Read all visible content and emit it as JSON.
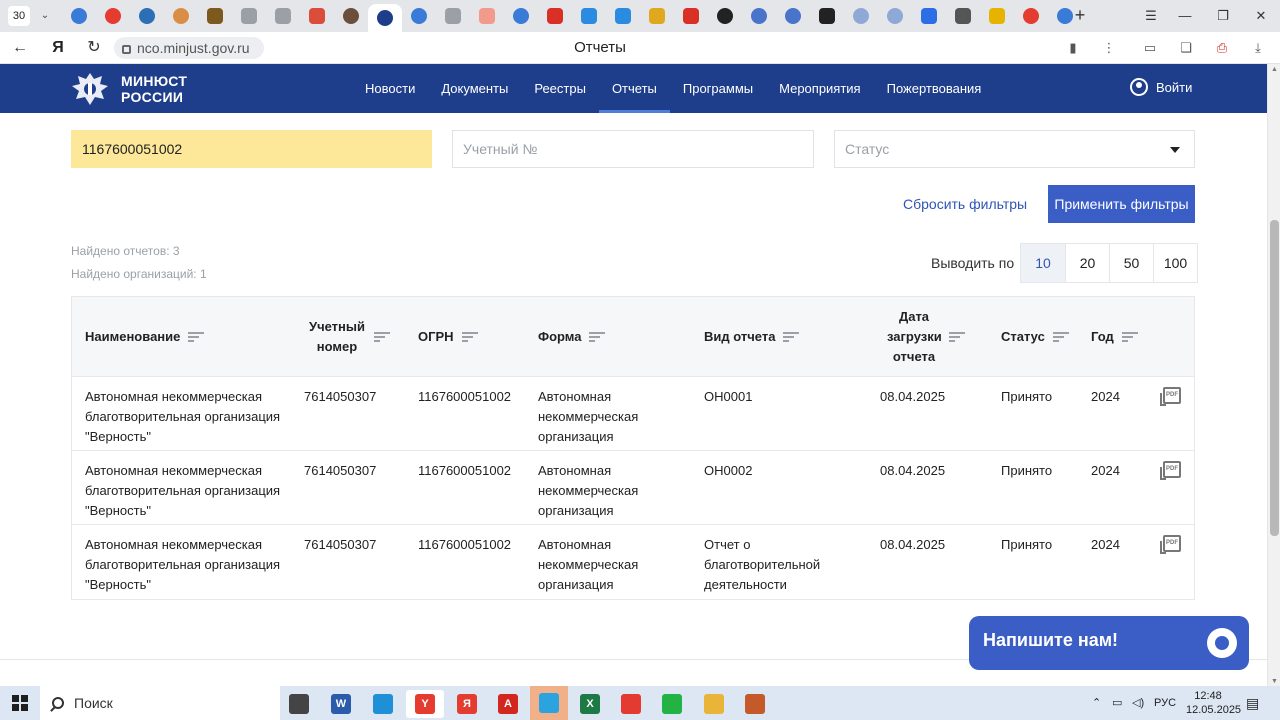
{
  "browser": {
    "tab_count": "30",
    "tab_icons": [
      {
        "name": "edge-tab-icon",
        "color": "#3b7bd8",
        "round": true
      },
      {
        "name": "yandex-tab-icon",
        "color": "#e43c2f",
        "round": true
      },
      {
        "name": "site-tab-icon",
        "color": "#2c6fb5",
        "round": true
      },
      {
        "name": "bunny-tab-icon",
        "color": "#d88f45",
        "round": true
      },
      {
        "name": "mask-tab-icon",
        "color": "#7c5a1e",
        "round": false
      },
      {
        "name": "document-tab-icon",
        "color": "#9aa0a6",
        "round": false
      },
      {
        "name": "document-tab-icon",
        "color": "#9aa0a6",
        "round": false
      },
      {
        "name": "grid-tab-icon",
        "color": "#d94d3a",
        "round": false
      },
      {
        "name": "avatar-tab-icon",
        "color": "#6b4f3a",
        "round": true
      },
      {
        "name": "minjust-tab-icon",
        "color": "#1e3e8c",
        "round": true,
        "active": true
      },
      {
        "name": "edge-tab-icon",
        "color": "#3b7bd8",
        "round": true
      },
      {
        "name": "document-tab-icon",
        "color": "#9aa0a6",
        "round": false
      },
      {
        "name": "file-tab-icon",
        "color": "#f29b8c",
        "round": false
      },
      {
        "name": "edge-tab-icon",
        "color": "#3b7bd8",
        "round": true
      },
      {
        "name": "house-tab-icon",
        "color": "#d93025",
        "round": false
      },
      {
        "name": "shield-tab-icon",
        "color": "#2b8be0",
        "round": false
      },
      {
        "name": "shield-tab-icon",
        "color": "#2b8be0",
        "round": false
      },
      {
        "name": "lock-tab-icon",
        "color": "#e0a81e",
        "round": false
      },
      {
        "name": "gmail-tab-icon",
        "color": "#d93025",
        "round": false
      },
      {
        "name": "arrow-tab-icon",
        "color": "#222222",
        "round": true
      },
      {
        "name": "crown-tab-icon",
        "color": "#4a74c9",
        "round": true
      },
      {
        "name": "crown-tab-icon",
        "color": "#4a74c9",
        "round": true
      },
      {
        "name": "tv-tab-icon",
        "color": "#222222",
        "round": false
      },
      {
        "name": "site-tab-icon",
        "color": "#8fa9d6",
        "round": true
      },
      {
        "name": "site-tab-icon",
        "color": "#8fa9d6",
        "round": true
      },
      {
        "name": "docs-tab-icon",
        "color": "#2b6ee6",
        "round": false
      },
      {
        "name": "flag-tab-icon",
        "color": "#555555",
        "round": false
      },
      {
        "name": "mail-tab-icon",
        "color": "#e6b400",
        "round": false
      },
      {
        "name": "yandex-tab-icon",
        "color": "#e43c2f",
        "round": true
      },
      {
        "name": "edge-tab-icon",
        "color": "#3b7bd8",
        "round": true
      }
    ],
    "url": "nco.minjust.gov.ru",
    "page_title": "Отчеты"
  },
  "site": {
    "brand_line1": "МИНЮСТ",
    "brand_line2": "РОССИИ",
    "nav": [
      {
        "label": "Новости",
        "active": false
      },
      {
        "label": "Документы",
        "active": false
      },
      {
        "label": "Реестры",
        "active": false
      },
      {
        "label": "Отчеты",
        "active": true
      },
      {
        "label": "Программы",
        "active": false
      },
      {
        "label": "Мероприятия",
        "active": false
      },
      {
        "label": "Пожертвования",
        "active": false
      }
    ],
    "login_label": "Войти",
    "primary_color": "#1e3e8c",
    "accent_color": "#3b5ec6"
  },
  "filters": {
    "ogrn_value": "1167600051002",
    "uchet_placeholder": "Учетный №",
    "status_placeholder": "Статус",
    "reset_label": "Сбросить фильтры",
    "apply_label": "Применить фильтры"
  },
  "summary": {
    "reports_label": "Найдено отчетов:",
    "reports_count": "3",
    "orgs_label": "Найдено организаций:",
    "orgs_count": "1"
  },
  "pagination": {
    "label": "Выводить по",
    "options": [
      "10",
      "20",
      "50",
      "100"
    ],
    "selected": "10"
  },
  "table": {
    "columns": [
      {
        "key": "name",
        "label": "Наименование"
      },
      {
        "key": "uchet",
        "label": "Учетный номер"
      },
      {
        "key": "ogrn",
        "label": "ОГРН"
      },
      {
        "key": "form",
        "label": "Форма"
      },
      {
        "key": "type",
        "label": "Вид отчета"
      },
      {
        "key": "date",
        "label": "Дата загрузки отчета"
      },
      {
        "key": "status",
        "label": "Статус"
      },
      {
        "key": "year",
        "label": "Год"
      }
    ],
    "rows": [
      {
        "name": "Автономная некоммерческая благотворительная организация \"Верность\"",
        "uchet": "7614050307",
        "ogrn": "1167600051002",
        "form": "Автономная некоммерческая организация",
        "type": "ОН0001",
        "date": "08.04.2025",
        "status": "Принято",
        "year": "2024"
      },
      {
        "name": "Автономная некоммерческая благотворительная организация \"Верность\"",
        "uchet": "7614050307",
        "ogrn": "1167600051002",
        "form": "Автономная некоммерческая организация",
        "type": "ОН0002",
        "date": "08.04.2025",
        "status": "Принято",
        "year": "2024"
      },
      {
        "name": "Автономная некоммерческая благотворительная организация \"Верность\"",
        "uchet": "7614050307",
        "ogrn": "1167600051002",
        "form": "Автономная некоммерческая организация",
        "type": "Отчет о благотворительной деятельности",
        "date": "08.04.2025",
        "status": "Принято",
        "year": "2024"
      }
    ],
    "pdf_icon_text": "PDF"
  },
  "chat": {
    "label": "Напишите нам!"
  },
  "taskbar": {
    "search_label": "Поиск",
    "apps": [
      {
        "name": "task-view-icon",
        "color": "#444444",
        "glyph": ""
      },
      {
        "name": "word-app-icon",
        "color": "#2b5cab",
        "glyph": "W"
      },
      {
        "name": "edge-app-icon",
        "color": "#1f8fd6",
        "glyph": ""
      },
      {
        "name": "yandex-browser-app-icon",
        "color": "#e43c2f",
        "glyph": "Y",
        "active": true
      },
      {
        "name": "yandex-app-icon",
        "color": "#e43c2f",
        "glyph": "Я"
      },
      {
        "name": "acrobat-app-icon",
        "color": "#d3261e",
        "glyph": "A"
      },
      {
        "name": "telegram-app-icon",
        "color": "#2aa3de",
        "glyph": "",
        "highlight": true
      },
      {
        "name": "excel-app-icon",
        "color": "#1d7a45",
        "glyph": "X"
      },
      {
        "name": "anydesk-app-icon",
        "color": "#e53a2f",
        "glyph": ""
      },
      {
        "name": "whatsapp-app-icon",
        "color": "#25b244",
        "glyph": ""
      },
      {
        "name": "explorer-app-icon",
        "color": "#e8b53a",
        "glyph": ""
      },
      {
        "name": "app-icon",
        "color": "#c45a2a",
        "glyph": ""
      }
    ],
    "language": "РУС",
    "time": "12:48",
    "date": "12.05.2025"
  }
}
